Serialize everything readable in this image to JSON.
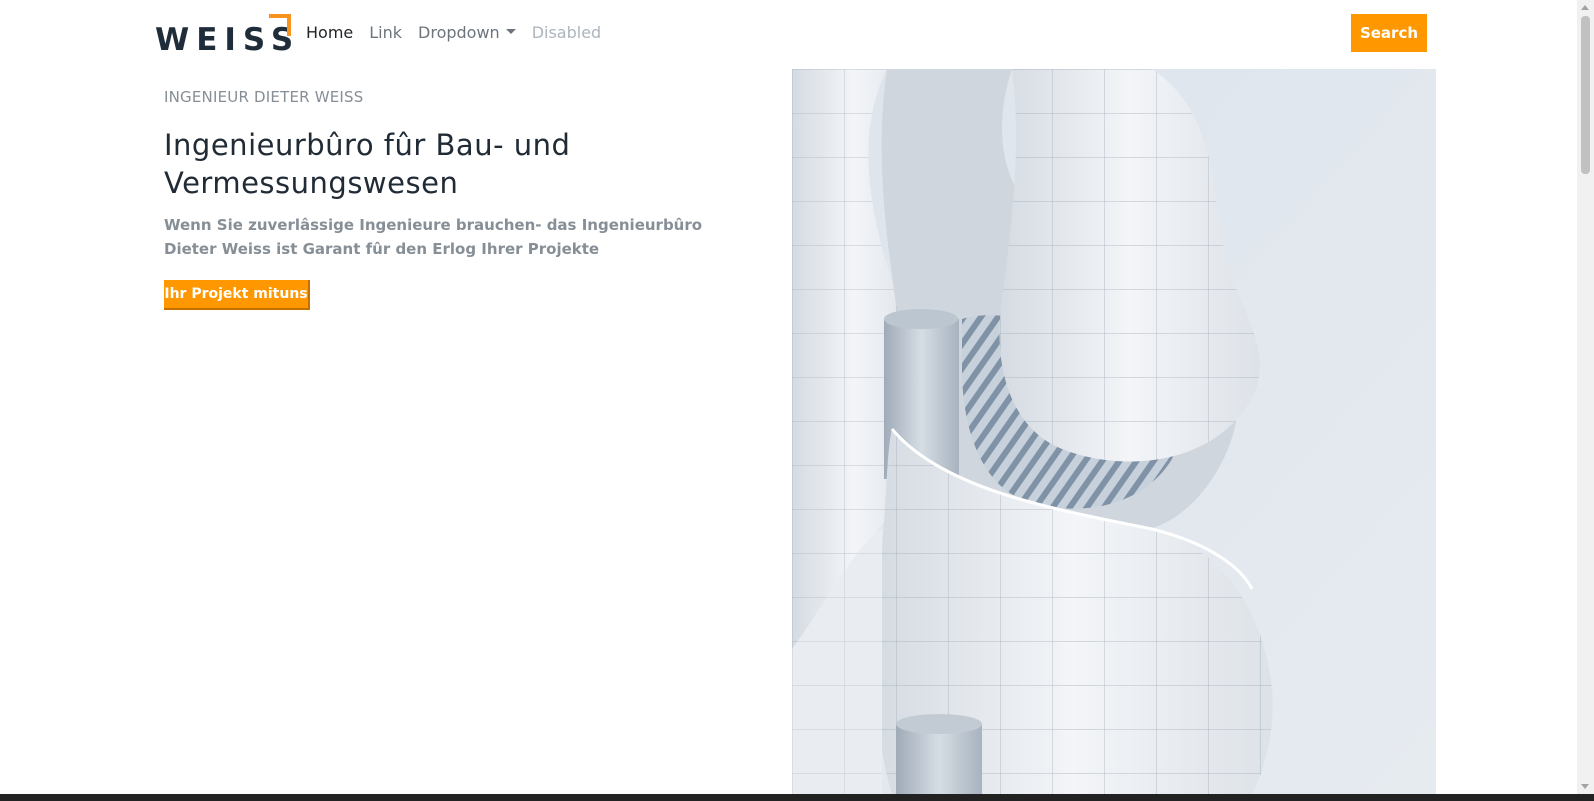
{
  "brand": {
    "name": "WEISS"
  },
  "nav": {
    "items": [
      {
        "label": "Home",
        "state": "active"
      },
      {
        "label": "Link",
        "state": "normal"
      },
      {
        "label": "Dropdown",
        "state": "normal"
      },
      {
        "label": "Disabled",
        "state": "disabled"
      }
    ],
    "search_label": "Search"
  },
  "hero": {
    "eyebrow": "INGENIEUR DIETER WEISS",
    "title": "Ingenieurbûro fûr Bau- und Vermessungswesen",
    "lead": "Wenn Sie zuverlâssige Ingenieure brauchen- das Ingenieurbûro Dieter Weiss ist Garant fûr den Erlog Ihrer Projekte",
    "cta_label": "Ihr Projekt mituns"
  },
  "colors": {
    "accent": "#ff9800",
    "logo_dark": "#1f2d3a",
    "muted_text": "#868e96"
  }
}
